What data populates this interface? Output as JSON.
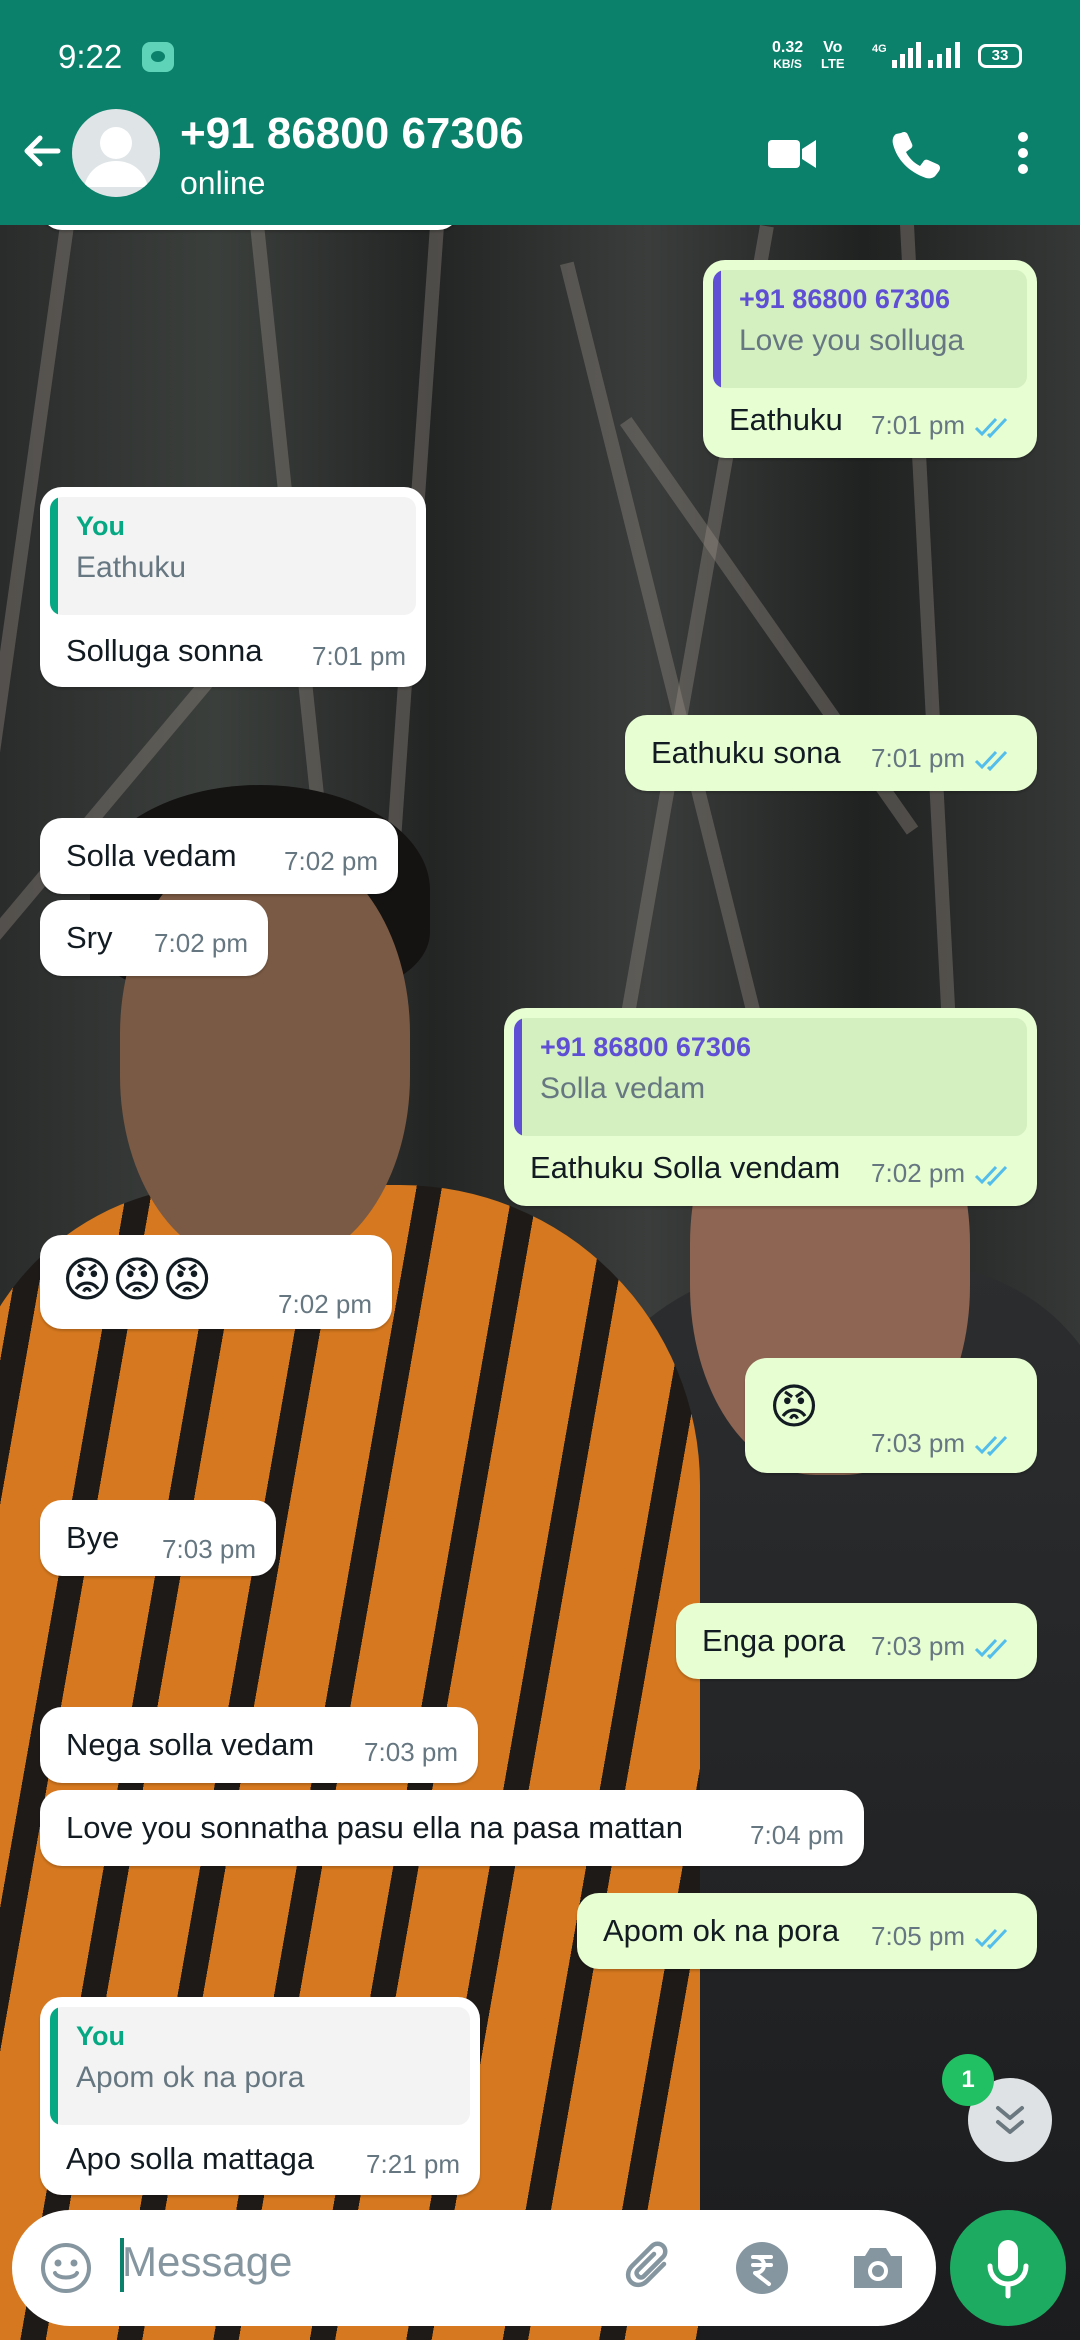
{
  "status_bar": {
    "time": "9:22",
    "net_speed_value": "0.32",
    "net_speed_unit": "KB/S",
    "volte_1": "Vo",
    "volte_2": "LTE",
    "battery": "33"
  },
  "header": {
    "contact_name": "+91 86800 67306",
    "status": "online"
  },
  "colors": {
    "header": "#0b806a",
    "outgoing_bubble": "#e7fdd2",
    "incoming_bubble": "#ffffff",
    "read_ticks": "#53bdeb",
    "you_quote": "#06a884",
    "contact_quote": "#5e4fd5",
    "mic_button": "#1daa61"
  },
  "messages": [
    {
      "dir": "out",
      "quote_name": "+91 86800 67306",
      "quote_text": "Love you solluga",
      "text": "Eathuku",
      "time": "7:01 pm"
    },
    {
      "dir": "in",
      "quote_name": "You",
      "quote_text": "Eathuku",
      "text": "Solluga sonna",
      "time": "7:01 pm"
    },
    {
      "dir": "out",
      "text": "Eathuku sona",
      "time": "7:01 pm"
    },
    {
      "dir": "in",
      "text": "Solla vedam",
      "time": "7:02 pm"
    },
    {
      "dir": "in",
      "text": "Sry",
      "time": "7:02 pm"
    },
    {
      "dir": "out",
      "quote_name": "+91 86800 67306",
      "quote_text": "Solla vedam",
      "text": "Eathuku Solla vendam",
      "time": "7:02 pm"
    },
    {
      "dir": "in",
      "text": "😡😡😡",
      "time": "7:02 pm"
    },
    {
      "dir": "out",
      "text": "😡",
      "time": "7:03 pm"
    },
    {
      "dir": "in",
      "text": "Bye",
      "time": "7:03 pm"
    },
    {
      "dir": "out",
      "text": "Enga pora",
      "time": "7:03 pm"
    },
    {
      "dir": "in",
      "text": "Nega solla vedam",
      "time": "7:03 pm"
    },
    {
      "dir": "in",
      "text": "Love you sonnatha pasu ella na  pasa mattan",
      "time": "7:04 pm"
    },
    {
      "dir": "out",
      "text": "Apom ok na pora",
      "time": "7:05 pm"
    },
    {
      "dir": "in",
      "quote_name": "You",
      "quote_text": "Apom ok na pora",
      "text": "Apo solla mattaga",
      "time": "7:21 pm"
    }
  ],
  "scroll_down": {
    "unread_count": "1"
  },
  "composer": {
    "placeholder": "Message",
    "icons": [
      "emoji-icon",
      "attach-icon",
      "rupee-icon",
      "camera-icon",
      "mic-icon"
    ]
  }
}
